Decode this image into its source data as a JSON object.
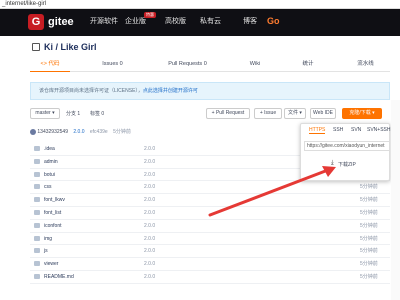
{
  "browser": {
    "url_fragment": "_internet/like-girl"
  },
  "navbar": {
    "logo_letter": "G",
    "brand": "gitee",
    "items": [
      "开源软件",
      "企业版",
      "高校版",
      "私有云",
      "博客",
      "Go"
    ],
    "badge": "特惠"
  },
  "repo": {
    "title": "Ki / Like Girl"
  },
  "tabs": [
    {
      "label": "<> 代码",
      "active": true
    },
    {
      "label": "Issues 0",
      "active": false
    },
    {
      "label": "Pull Requests 0",
      "active": false
    },
    {
      "label": "Wiki",
      "active": false
    },
    {
      "label": "统计",
      "active": false
    },
    {
      "label": "流水线",
      "active": false
    }
  ],
  "notice": {
    "text": "该仓库开源项目尚未选择许可证（LICENSE），",
    "link": "点此选择并创建开源许可"
  },
  "toolbar": {
    "branch": "master ▾",
    "branches": "分支 1",
    "tags": "标签 0",
    "pull_request": "+ Pull Request",
    "issue": "+ Issue",
    "file": "文件 ▾",
    "webide": "Web IDE",
    "clone": "克隆/下载 ▾"
  },
  "commit": {
    "user": "13432932549",
    "version": "2.0.0",
    "hash": "efc439e",
    "time": "5分钟前"
  },
  "files": [
    {
      "name": ".idea",
      "msg": "2.0.0",
      "time": "5分钟前"
    },
    {
      "name": "admin",
      "msg": "2.0.0",
      "time": "5分钟前"
    },
    {
      "name": "botui",
      "msg": "2.0.0",
      "time": "5分钟前"
    },
    {
      "name": "css",
      "msg": "2.0.0",
      "time": "5分钟前"
    },
    {
      "name": "font_lkwv",
      "msg": "2.0.0",
      "time": "5分钟前"
    },
    {
      "name": "font_list",
      "msg": "2.0.0",
      "time": "5分钟前"
    },
    {
      "name": "iconfont",
      "msg": "2.0.0",
      "time": "5分钟前"
    },
    {
      "name": "img",
      "msg": "2.0.0",
      "time": "5分钟前"
    },
    {
      "name": "js",
      "msg": "2.0.0",
      "time": "5分钟前"
    },
    {
      "name": "viewer",
      "msg": "2.0.0",
      "time": "5分钟前"
    },
    {
      "name": "README.md",
      "msg": "2.0.0",
      "time": "5分钟前"
    }
  ],
  "dropdown": {
    "tabs": [
      "HTTPS",
      "SSH",
      "SVN",
      "SVN+SSH"
    ],
    "url": "https://gitee.com/xiaodyun_internet",
    "download": "下载ZIP"
  },
  "colors": {
    "accent": "#fe7300",
    "navbar": "#0f0f14",
    "arrow": "#e53935"
  }
}
